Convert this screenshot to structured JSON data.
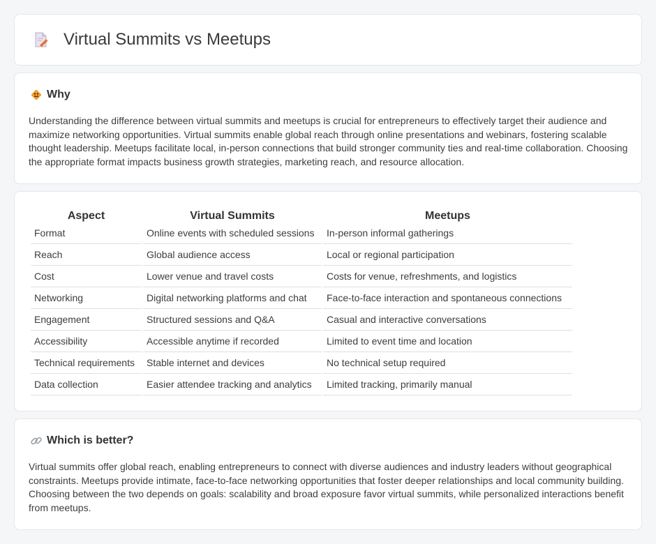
{
  "header": {
    "title": "Virtual Summits vs Meetups",
    "icon": "document-pencil-icon"
  },
  "why": {
    "icon": "road-sign-icon",
    "title": "Why",
    "body": "Understanding the difference between virtual summits and meetups is crucial for entrepreneurs to effectively target their audience and maximize networking opportunities. Virtual summits enable global reach through online presentations and webinars, fostering scalable thought leadership. Meetups facilitate local, in-person connections that build stronger community ties and real-time collaboration. Choosing the appropriate format impacts business growth strategies, marketing reach, and resource allocation."
  },
  "table": {
    "headers": [
      "Aspect",
      "Virtual Summits",
      "Meetups"
    ],
    "rows": [
      [
        "Format",
        "Online events with scheduled sessions",
        "In-person informal gatherings"
      ],
      [
        "Reach",
        "Global audience access",
        "Local or regional participation"
      ],
      [
        "Cost",
        "Lower venue and travel costs",
        "Costs for venue, refreshments, and logistics"
      ],
      [
        "Networking",
        "Digital networking platforms and chat",
        "Face-to-face interaction and spontaneous connections"
      ],
      [
        "Engagement",
        "Structured sessions and Q&A",
        "Casual and interactive conversations"
      ],
      [
        "Accessibility",
        "Accessible anytime if recorded",
        "Limited to event time and location"
      ],
      [
        "Technical requirements",
        "Stable internet and devices",
        "No technical setup required"
      ],
      [
        "Data collection",
        "Easier attendee tracking and analytics",
        "Limited tracking, primarily manual"
      ]
    ]
  },
  "better": {
    "icon": "link-icon",
    "title": "Which is better?",
    "body": "Virtual summits offer global reach, enabling entrepreneurs to connect with diverse audiences and industry leaders without geographical constraints. Meetups provide intimate, face-to-face networking opportunities that foster deeper relationships and local community building. Choosing between the two depends on goals: scalability and broad exposure favor virtual summits, while personalized interactions benefit from meetups."
  },
  "colors": {
    "page_background": "#f5f6f8",
    "card_background": "#ffffff",
    "sign_orange": "#f0a030",
    "pencil_orange": "#e8703a"
  }
}
